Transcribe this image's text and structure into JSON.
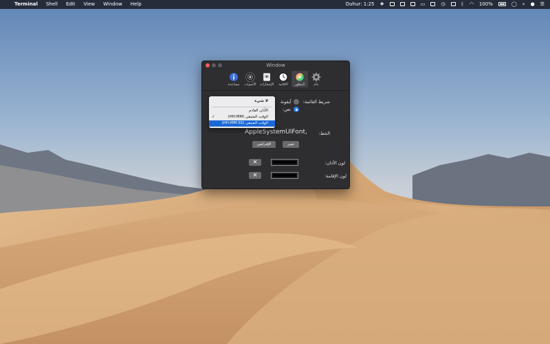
{
  "menubar": {
    "apple": "",
    "app_name": "Terminal",
    "menus": [
      "Shell",
      "Edit",
      "View",
      "Window",
      "Help"
    ],
    "prayer_time": "Duhur: 1:25",
    "battery": "100%"
  },
  "window": {
    "title": "Window",
    "toolbar": [
      {
        "label": "عام",
        "icon": "gear-icon"
      },
      {
        "label": "المظهر",
        "icon": "color-wheel-icon",
        "selected": true
      },
      {
        "label": "الاقامة",
        "icon": "clock-icon"
      },
      {
        "label": "الإشعارات",
        "icon": "notification-icon"
      },
      {
        "label": "الأصوات",
        "icon": "speaker-icon"
      },
      {
        "label": "مساعدة",
        "icon": "info-icon"
      }
    ],
    "menubar_label": "شريط القائمة:",
    "option_icon": "أيقونة",
    "option_text": "نص:",
    "font_label": "الخط:",
    "font_name": "AppleSystemUIFont,",
    "change_button": "تغيير",
    "default_button": "الإفتراضي",
    "adhan_color_label": "لون الأذان:",
    "iqama_color_label": "لون الإقامة:",
    "clear_symbol": "✕"
  },
  "dropdown": {
    "items": [
      {
        "label": "لا شيء",
        "bold": true
      },
      {
        "label": "الأذان القادم"
      },
      {
        "label": "الوقت المتبقي (HH:MM)",
        "checked": true
      },
      {
        "label": "الوقت المتبقي (HH:MM:SS)",
        "highlighted": true
      }
    ],
    "check_symbol": "✓"
  }
}
